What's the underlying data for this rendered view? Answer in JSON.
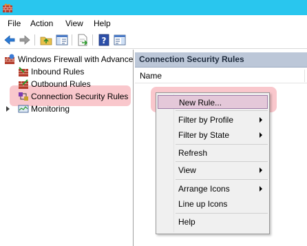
{
  "window": {
    "title_bar_color": "#29c6ee",
    "app_icon": "firewall-brick-icon"
  },
  "menubar": {
    "items": [
      "File",
      "Action",
      "View",
      "Help"
    ]
  },
  "toolbar": {
    "icons": [
      "back-arrow-icon",
      "forward-arrow-icon",
      "up-folder-icon",
      "show-hide-console-tree-icon",
      "export-list-icon",
      "help-icon",
      "show-hide-action-pane-icon"
    ]
  },
  "tree": {
    "root": "Windows Firewall with Advance",
    "items": [
      "Inbound Rules",
      "Outbound Rules",
      "Connection Security Rules",
      "Monitoring"
    ],
    "highlight_color": "#f9c7cc"
  },
  "main": {
    "header": "Connection Security Rules",
    "column_header": "Name"
  },
  "context_menu": {
    "items": [
      {
        "label": "New Rule...",
        "submenu": false
      },
      {
        "label": "Filter by Profile",
        "submenu": true
      },
      {
        "label": "Filter by State",
        "submenu": true
      },
      {
        "label": "Refresh",
        "submenu": false
      },
      {
        "label": "View",
        "submenu": true
      },
      {
        "label": "Arrange Icons",
        "submenu": true
      },
      {
        "label": "Line up Icons",
        "submenu": false
      },
      {
        "label": "Help",
        "submenu": false
      }
    ],
    "selected_color": "#e4c8d9"
  }
}
